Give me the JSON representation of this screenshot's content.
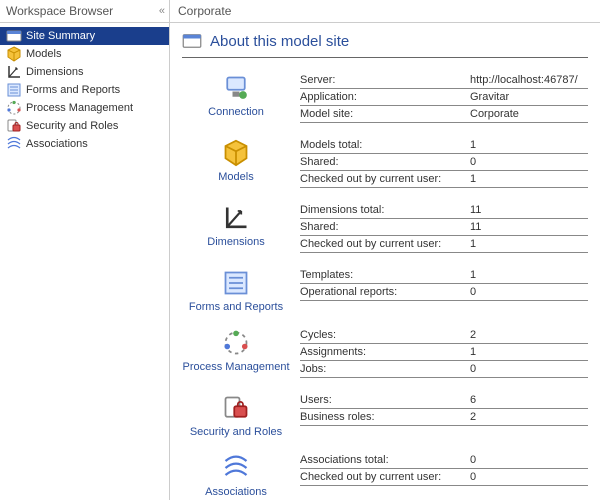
{
  "sidebar": {
    "title": "Workspace Browser",
    "items": [
      {
        "icon": "site-summary",
        "label": "Site Summary",
        "selected": true
      },
      {
        "icon": "models",
        "label": "Models",
        "selected": false
      },
      {
        "icon": "dimensions",
        "label": "Dimensions",
        "selected": false
      },
      {
        "icon": "forms",
        "label": "Forms and Reports",
        "selected": false
      },
      {
        "icon": "process",
        "label": "Process Management",
        "selected": false
      },
      {
        "icon": "security",
        "label": "Security and Roles",
        "selected": false
      },
      {
        "icon": "associations",
        "label": "Associations",
        "selected": false
      }
    ]
  },
  "main": {
    "breadcrumb": "Corporate",
    "title": "About this model site",
    "sections": [
      {
        "icon": "connection",
        "label": "Connection",
        "rows": [
          {
            "label": "Server:",
            "value": "http://localhost:46787/"
          },
          {
            "label": "Application:",
            "value": "Gravitar"
          },
          {
            "label": "Model site:",
            "value": "Corporate"
          }
        ]
      },
      {
        "icon": "models",
        "label": "Models",
        "rows": [
          {
            "label": "Models total:",
            "value": "1"
          },
          {
            "label": "Shared:",
            "value": "0"
          },
          {
            "label": "Checked out by current user:",
            "value": "1"
          }
        ]
      },
      {
        "icon": "dimensions",
        "label": "Dimensions",
        "rows": [
          {
            "label": "Dimensions total:",
            "value": "11"
          },
          {
            "label": "Shared:",
            "value": "11"
          },
          {
            "label": "Checked out by current user:",
            "value": "1"
          }
        ]
      },
      {
        "icon": "forms",
        "label": "Forms and Reports",
        "rows": [
          {
            "label": "Templates:",
            "value": "1"
          },
          {
            "label": "Operational reports:",
            "value": "0"
          }
        ]
      },
      {
        "icon": "process",
        "label": "Process Management",
        "rows": [
          {
            "label": "Cycles:",
            "value": "2"
          },
          {
            "label": "Assignments:",
            "value": "1"
          },
          {
            "label": "Jobs:",
            "value": "0"
          }
        ]
      },
      {
        "icon": "security",
        "label": "Security and Roles",
        "rows": [
          {
            "label": "Users:",
            "value": "6"
          },
          {
            "label": "Business roles:",
            "value": "2"
          }
        ]
      },
      {
        "icon": "associations",
        "label": "Associations",
        "rows": [
          {
            "label": "Associations total:",
            "value": "0"
          },
          {
            "label": "Checked out by current user:",
            "value": "0"
          }
        ]
      }
    ]
  }
}
